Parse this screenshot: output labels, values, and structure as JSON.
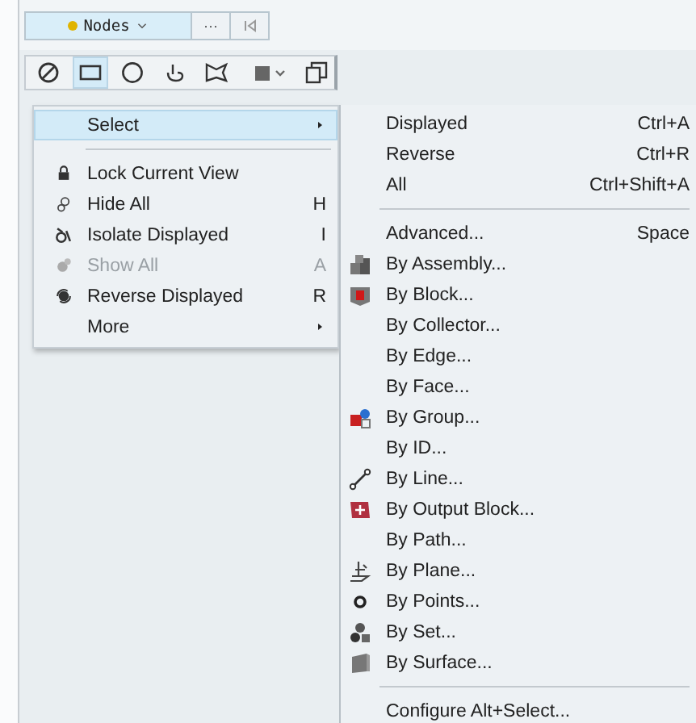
{
  "top_bar": {
    "entity_selector": {
      "label": "Nodes"
    },
    "more_button": "···"
  },
  "toolbar": {
    "tools": [
      {
        "kind": "none",
        "selected": false
      },
      {
        "kind": "rectangle",
        "selected": true
      },
      {
        "kind": "circle",
        "selected": false
      },
      {
        "kind": "freehand",
        "selected": false
      },
      {
        "kind": "polygon",
        "selected": false
      },
      {
        "kind": "fill",
        "selected": false
      },
      {
        "kind": "copy",
        "selected": false
      }
    ]
  },
  "menu": {
    "items": [
      {
        "kind": "plain",
        "label": "Select",
        "submenu": true,
        "selected": true,
        "disabled": false
      },
      {
        "kind": "separator"
      },
      {
        "kind": "lock",
        "label": "Lock Current View",
        "selected": false,
        "disabled": false
      },
      {
        "kind": "hide",
        "label": "Hide All",
        "shortcut": "H",
        "selected": false,
        "disabled": false
      },
      {
        "kind": "isolate",
        "label": "Isolate Displayed",
        "shortcut": "I",
        "selected": false,
        "disabled": false
      },
      {
        "kind": "show",
        "label": "Show All",
        "shortcut": "A",
        "selected": false,
        "disabled": true
      },
      {
        "kind": "reverse",
        "label": "Reverse Displayed",
        "shortcut": "R",
        "selected": false,
        "disabled": false
      },
      {
        "kind": "plain",
        "label": "More",
        "submenu": true,
        "selected": false,
        "disabled": false
      }
    ]
  },
  "submenu": {
    "items": [
      {
        "kind": "plain",
        "label": "Displayed",
        "shortcut": "Ctrl+A"
      },
      {
        "kind": "plain",
        "label": "Reverse",
        "shortcut": "Ctrl+R"
      },
      {
        "kind": "plain",
        "label": "All",
        "shortcut": "Ctrl+Shift+A"
      },
      {
        "kind": "separator"
      },
      {
        "kind": "plain",
        "label": "Advanced...",
        "shortcut": "Space"
      },
      {
        "kind": "assembly",
        "label": "By Assembly..."
      },
      {
        "kind": "block",
        "label": "By Block..."
      },
      {
        "kind": "plain",
        "label": "By Collector..."
      },
      {
        "kind": "plain",
        "label": "By Edge..."
      },
      {
        "kind": "plain",
        "label": "By Face..."
      },
      {
        "kind": "group",
        "label": "By Group..."
      },
      {
        "kind": "plain",
        "label": "By ID..."
      },
      {
        "kind": "line",
        "label": "By Line..."
      },
      {
        "kind": "output",
        "label": "By Output Block..."
      },
      {
        "kind": "plain",
        "label": "By Path..."
      },
      {
        "kind": "plane",
        "label": "By Plane..."
      },
      {
        "kind": "points",
        "label": "By Points..."
      },
      {
        "kind": "set",
        "label": "By Set..."
      },
      {
        "kind": "surface",
        "label": "By Surface..."
      },
      {
        "kind": "separator"
      },
      {
        "kind": "plain",
        "label": "Configure Alt+Select..."
      }
    ]
  }
}
